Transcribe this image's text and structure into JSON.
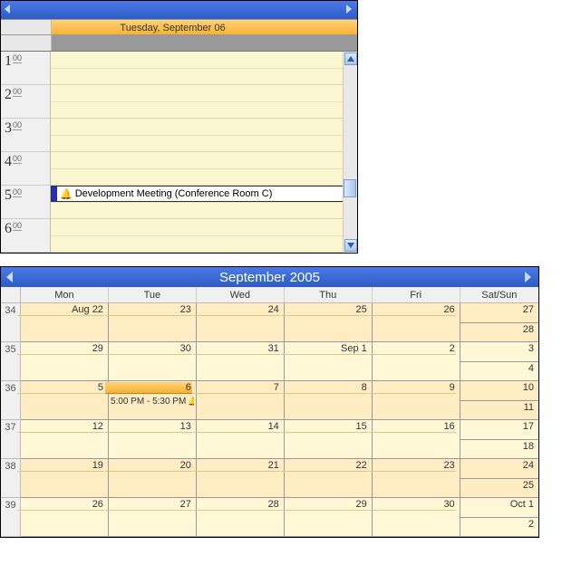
{
  "dayview": {
    "date_label": "Tuesday, September 06",
    "hours": [
      "1",
      "2",
      "3",
      "4",
      "5",
      "6"
    ],
    "minute_label": "00",
    "appointment": {
      "title": "Development Meeting (Conference Room C)",
      "hour_index": 4,
      "has_reminder": true
    }
  },
  "monthview": {
    "title": "September 2005",
    "day_headers": [
      "Mon",
      "Tue",
      "Wed",
      "Thu",
      "Fri",
      "Sat/Sun"
    ],
    "week_numbers": [
      "34",
      "35",
      "36",
      "37",
      "38",
      "39"
    ],
    "weeks": [
      {
        "alt": true,
        "cells": [
          "Aug 22",
          "23",
          "24",
          "25",
          "26"
        ],
        "weekend": [
          "27",
          "28"
        ]
      },
      {
        "alt": false,
        "cells": [
          "29",
          "30",
          "31",
          "Sep 1",
          "2"
        ],
        "weekend": [
          "3",
          "4"
        ]
      },
      {
        "alt": true,
        "cells": [
          "5",
          "6",
          "7",
          "8",
          "9"
        ],
        "weekend": [
          "10",
          "11"
        ],
        "today_col": 1,
        "event": {
          "col": 1,
          "label": "5:00 PM - 5:30 PM",
          "bell": true
        }
      },
      {
        "alt": false,
        "cells": [
          "12",
          "13",
          "14",
          "15",
          "16"
        ],
        "weekend": [
          "17",
          "18"
        ]
      },
      {
        "alt": true,
        "cells": [
          "19",
          "20",
          "21",
          "22",
          "23"
        ],
        "weekend": [
          "24",
          "25"
        ]
      },
      {
        "alt": false,
        "cells": [
          "26",
          "27",
          "28",
          "29",
          "30"
        ],
        "weekend": [
          "Oct 1",
          "2"
        ]
      }
    ]
  }
}
